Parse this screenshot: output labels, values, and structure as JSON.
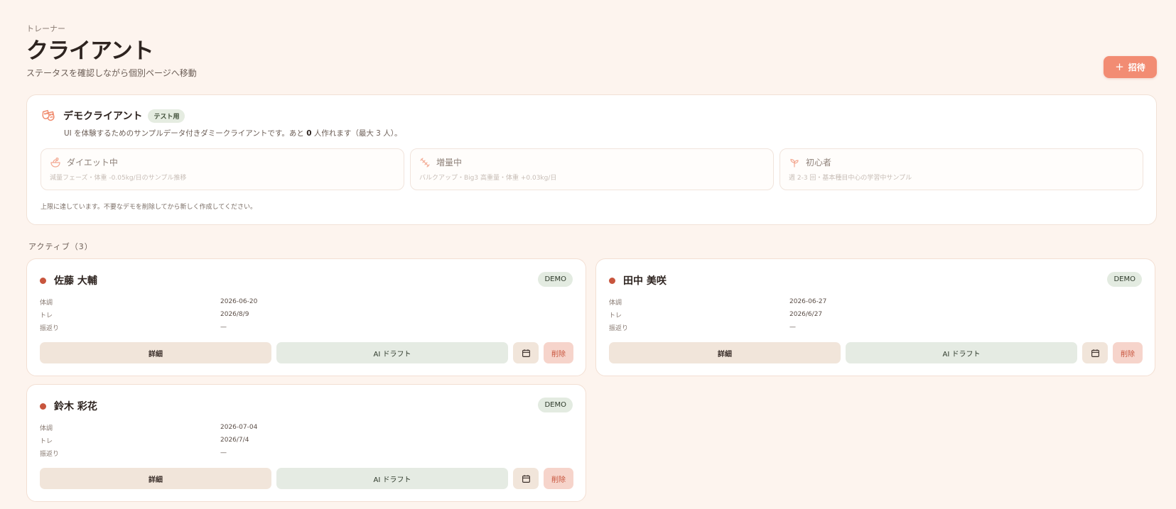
{
  "header": {
    "eyebrow": "トレーナー",
    "title": "クライアント",
    "subtitle": "ステータスを確認しながら個別ページへ移動",
    "invite_label": "招待",
    "invite_icon": "plus-icon"
  },
  "demo": {
    "title": "デモクライアント",
    "badge": "テスト用",
    "desc_prefix": "UI を体験するためのサンプルデータ付きダミークライアントです。あと",
    "desc_count": "0",
    "desc_suffix": "人作れます（最大 3 人）。",
    "templates": [
      {
        "name": "ダイエット中",
        "desc": "減量フェーズ・体重 -0.05kg/日のサンプル推移",
        "icon": "salad-icon"
      },
      {
        "name": "増量中",
        "desc": "バルクアップ・Big3 高重量・体重 +0.03kg/日",
        "icon": "dumbbell-icon"
      },
      {
        "name": "初心者",
        "desc": "週 2-3 回・基本種目中心の学習中サンプル",
        "icon": "sprout-icon"
      }
    ],
    "limit_note": "上限に達しています。不要なデモを削除してから新しく作成してください。"
  },
  "active_section": {
    "label": "アクティブ（3）"
  },
  "row_labels": {
    "condition": "体調",
    "training": "トレ",
    "review": "振返り"
  },
  "buttons": {
    "detail": "詳細",
    "ai_draft": "AI ドラフト",
    "delete": "削除"
  },
  "clients": [
    {
      "name": "佐藤 大輔",
      "tag": "DEMO",
      "condition": "2026-06-20",
      "training": "2026/8/9",
      "review": "—"
    },
    {
      "name": "田中 美咲",
      "tag": "DEMO",
      "condition": "2026-06-27",
      "training": "2026/6/27",
      "review": "—"
    },
    {
      "name": "鈴木 彩花",
      "tag": "DEMO",
      "condition": "2026-07-04",
      "training": "2026/7/4",
      "review": "—"
    }
  ],
  "colors": {
    "accent": "#f28c73",
    "status_dot": "#c8553d",
    "background": "#fdf4ee"
  }
}
